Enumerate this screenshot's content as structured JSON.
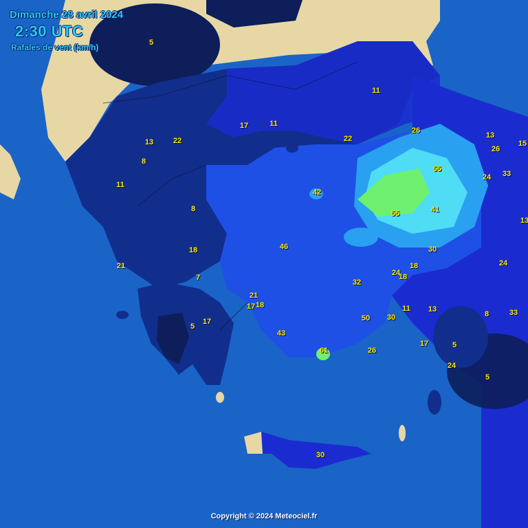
{
  "header": {
    "date": "Dimanche 28 avril 2024",
    "time": "2:30 UTC",
    "variable": "Rafales de vent (km/h)"
  },
  "copyright": "Copyright © 2024 Meteociel.fr",
  "colors": {
    "sea": "#1a64c8",
    "land": "#e6d7a5",
    "zone_0_10": "#0d1e5a",
    "zone_10_20": "#122e8c",
    "zone_20_25": "#1a2ccf",
    "zone_25_35": "#1e50e6",
    "zone_35_45": "#2aa0f0",
    "zone_45_55": "#4fdcf5",
    "zone_55_plus": "#6ef06e",
    "label": "#ffe600"
  },
  "labels": [
    "5",
    "11",
    "13",
    "22",
    "17",
    "11",
    "22",
    "26",
    "13",
    "26",
    "15",
    "8",
    "55",
    "24",
    "33",
    "11",
    "42",
    "41",
    "55",
    "8",
    "13",
    "18",
    "46",
    "30",
    "21",
    "18",
    "7",
    "24",
    "32",
    "18",
    "24",
    "21",
    "17",
    "18",
    "17",
    "5",
    "50",
    "30",
    "11",
    "13",
    "8",
    "33",
    "43",
    "17",
    "5",
    "61",
    "26",
    "24",
    "5",
    "30"
  ]
}
